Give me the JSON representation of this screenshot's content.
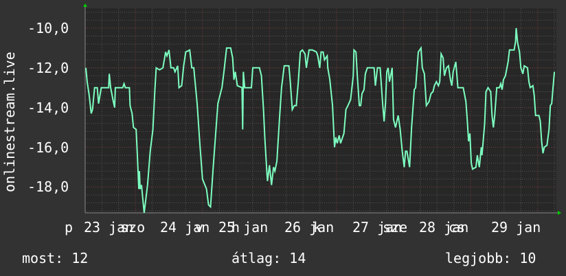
{
  "chart_data": {
    "type": "line",
    "title": "",
    "ylabel": "onlinestream.live",
    "xlabel": "",
    "ylim": [
      -19.3,
      -9.0
    ],
    "xlim": [
      23.25,
      30.28
    ],
    "grid": true,
    "y_ticks": [
      -10,
      -12,
      -14,
      -16,
      -18
    ],
    "y_tick_labels": [
      "-10,0",
      "-12,0",
      "-14,0",
      "-16,0",
      "-18,0"
    ],
    "x_tick_labels": [
      "23 jan",
      "24 jan",
      "25 jan",
      "26 jan",
      "27 jan",
      "28 jan",
      "29 jan"
    ],
    "x_weekday_labels": [
      "p",
      "szo",
      "v",
      "h",
      "k",
      "sze",
      "cs"
    ],
    "colors": {
      "line": "#7dffc0",
      "background": "#323232",
      "plot_background": "#272727",
      "major_grid": "#7a3a3a",
      "minor_grid": "#555555",
      "arrow": "#00cc00"
    },
    "series": [
      {
        "points": [
          [
            23.26,
            -12.0
          ],
          [
            23.28,
            -12.7
          ],
          [
            23.31,
            -13.4
          ],
          [
            23.34,
            -14.3
          ],
          [
            23.36,
            -14.1
          ],
          [
            23.39,
            -13.0
          ],
          [
            23.43,
            -13.0
          ],
          [
            23.45,
            -13.8
          ],
          [
            23.49,
            -13.0
          ],
          [
            23.6,
            -13.0
          ],
          [
            23.61,
            -12.3
          ],
          [
            23.63,
            -13.0
          ],
          [
            23.67,
            -13.7
          ],
          [
            23.69,
            -14.0
          ],
          [
            23.7,
            -13.0
          ],
          [
            23.81,
            -13.0
          ],
          [
            23.83,
            -12.8
          ],
          [
            23.85,
            -13.0
          ],
          [
            23.91,
            -13.0
          ],
          [
            23.92,
            -13.9
          ],
          [
            23.95,
            -14.3
          ],
          [
            23.97,
            -15.0
          ],
          [
            24.01,
            -15.1
          ],
          [
            24.03,
            -16.5
          ],
          [
            24.05,
            -18.1
          ],
          [
            24.06,
            -17.2
          ],
          [
            24.07,
            -18.1
          ],
          [
            24.09,
            -17.9
          ],
          [
            24.11,
            -18.6
          ],
          [
            24.13,
            -19.3
          ],
          [
            24.18,
            -17.9
          ],
          [
            24.22,
            -16.2
          ],
          [
            24.26,
            -15.1
          ],
          [
            24.29,
            -13.1
          ],
          [
            24.31,
            -12.0
          ],
          [
            24.36,
            -12.1
          ],
          [
            24.41,
            -12.0
          ],
          [
            24.45,
            -11.2
          ],
          [
            24.47,
            -11.4
          ],
          [
            24.5,
            -11.1
          ],
          [
            24.53,
            -12.0
          ],
          [
            24.57,
            -12.0
          ],
          [
            24.59,
            -12.2
          ],
          [
            24.63,
            -11.9
          ],
          [
            24.65,
            -13.0
          ],
          [
            24.69,
            -12.9
          ],
          [
            24.72,
            -11.9
          ],
          [
            24.75,
            -11.2
          ],
          [
            24.81,
            -11.1
          ],
          [
            24.84,
            -12.0
          ],
          [
            24.87,
            -12.0
          ],
          [
            24.92,
            -13.8
          ],
          [
            24.96,
            -15.8
          ],
          [
            25.0,
            -17.6
          ],
          [
            25.06,
            -18.1
          ],
          [
            25.09,
            -18.9
          ],
          [
            25.12,
            -19.0
          ],
          [
            25.16,
            -17.0
          ],
          [
            25.23,
            -13.8
          ],
          [
            25.29,
            -13.0
          ],
          [
            25.32,
            -12.2
          ],
          [
            25.36,
            -11.0
          ],
          [
            25.42,
            -11.0
          ],
          [
            25.45,
            -11.5
          ],
          [
            25.47,
            -12.6
          ],
          [
            25.49,
            -12.2
          ],
          [
            25.52,
            -12.9
          ],
          [
            25.59,
            -13.0
          ],
          [
            25.6,
            -15.1
          ],
          [
            25.61,
            -12.2
          ],
          [
            25.63,
            -13.0
          ],
          [
            25.73,
            -13.0
          ],
          [
            25.75,
            -12.0
          ],
          [
            25.85,
            -12.0
          ],
          [
            25.88,
            -12.4
          ],
          [
            25.91,
            -14.1
          ],
          [
            25.93,
            -15.5
          ],
          [
            25.96,
            -17.2
          ],
          [
            25.97,
            -17.7
          ],
          [
            26.0,
            -16.9
          ],
          [
            26.03,
            -17.9
          ],
          [
            26.06,
            -17.0
          ],
          [
            26.08,
            -17.2
          ],
          [
            26.11,
            -16.7
          ],
          [
            26.15,
            -14.5
          ],
          [
            26.18,
            -13.0
          ],
          [
            26.22,
            -11.9
          ],
          [
            26.29,
            -11.9
          ],
          [
            26.31,
            -12.7
          ],
          [
            26.34,
            -14.1
          ],
          [
            26.37,
            -13.9
          ],
          [
            26.4,
            -13.9
          ],
          [
            26.43,
            -12.7
          ],
          [
            26.46,
            -11.2
          ],
          [
            26.49,
            -11.1
          ],
          [
            26.53,
            -11.3
          ],
          [
            26.55,
            -12.0
          ],
          [
            26.59,
            -11.1
          ],
          [
            26.64,
            -11.1
          ],
          [
            26.7,
            -11.2
          ],
          [
            26.72,
            -11.4
          ],
          [
            26.75,
            -12.0
          ],
          [
            26.77,
            -11.2
          ],
          [
            26.8,
            -11.2
          ],
          [
            26.82,
            -11.6
          ],
          [
            26.86,
            -11.4
          ],
          [
            26.87,
            -12.0
          ],
          [
            26.9,
            -12.6
          ],
          [
            26.94,
            -13.9
          ],
          [
            26.97,
            -16.0
          ],
          [
            26.99,
            -15.5
          ],
          [
            27.01,
            -15.8
          ],
          [
            27.04,
            -15.4
          ],
          [
            27.06,
            -15.8
          ],
          [
            27.11,
            -15.3
          ],
          [
            27.14,
            -14.1
          ],
          [
            27.17,
            -13.9
          ],
          [
            27.21,
            -13.6
          ],
          [
            27.25,
            -12.4
          ],
          [
            27.26,
            -11.1
          ],
          [
            27.29,
            -11.2
          ],
          [
            27.31,
            -12.4
          ],
          [
            27.34,
            -13.9
          ],
          [
            27.36,
            -13.9
          ],
          [
            27.38,
            -13.3
          ],
          [
            27.41,
            -13.1
          ],
          [
            27.43,
            -12.3
          ],
          [
            27.46,
            -12.0
          ],
          [
            27.56,
            -12.0
          ],
          [
            27.58,
            -12.9
          ],
          [
            27.61,
            -12.0
          ],
          [
            27.65,
            -12.0
          ],
          [
            27.69,
            -13.9
          ],
          [
            27.71,
            -14.7
          ],
          [
            27.73,
            -13.8
          ],
          [
            27.75,
            -12.2
          ],
          [
            27.77,
            -12.0
          ],
          [
            27.79,
            -12.7
          ],
          [
            27.83,
            -12.0
          ],
          [
            27.85,
            -14.6
          ],
          [
            27.88,
            -15.0
          ],
          [
            27.92,
            -14.4
          ],
          [
            27.95,
            -15.1
          ],
          [
            27.98,
            -16.2
          ],
          [
            28.01,
            -17.0
          ],
          [
            28.03,
            -16.2
          ],
          [
            28.05,
            -16.2
          ],
          [
            28.09,
            -17.0
          ],
          [
            28.12,
            -15.0
          ],
          [
            28.16,
            -13.1
          ],
          [
            28.18,
            -13.0
          ],
          [
            28.22,
            -11.2
          ],
          [
            28.26,
            -11.0
          ],
          [
            28.28,
            -12.0
          ],
          [
            28.31,
            -12.3
          ],
          [
            28.34,
            -13.9
          ],
          [
            28.38,
            -13.7
          ],
          [
            28.41,
            -13.3
          ],
          [
            28.44,
            -13.2
          ],
          [
            28.46,
            -12.9
          ],
          [
            28.49,
            -12.7
          ],
          [
            28.52,
            -12.9
          ],
          [
            28.54,
            -12.7
          ],
          [
            28.56,
            -11.3
          ],
          [
            28.59,
            -11.5
          ],
          [
            28.61,
            -12.4
          ],
          [
            28.64,
            -12.0
          ],
          [
            28.67,
            -11.9
          ],
          [
            28.7,
            -12.6
          ],
          [
            28.72,
            -12.9
          ],
          [
            28.74,
            -12.2
          ],
          [
            28.78,
            -11.7
          ],
          [
            28.81,
            -13.0
          ],
          [
            28.89,
            -13.0
          ],
          [
            28.93,
            -13.7
          ],
          [
            28.95,
            -14.6
          ],
          [
            28.97,
            -15.7
          ],
          [
            28.99,
            -15.3
          ],
          [
            29.01,
            -16.8
          ],
          [
            29.03,
            -17.1
          ],
          [
            29.08,
            -17.0
          ],
          [
            29.1,
            -16.4
          ],
          [
            29.13,
            -17.0
          ],
          [
            29.16,
            -16.0
          ],
          [
            29.17,
            -16.4
          ],
          [
            29.21,
            -14.8
          ],
          [
            29.23,
            -13.2
          ],
          [
            29.26,
            -13.0
          ],
          [
            29.3,
            -13.2
          ],
          [
            29.32,
            -14.4
          ],
          [
            29.34,
            -15.0
          ],
          [
            29.36,
            -14.4
          ],
          [
            29.39,
            -13.0
          ],
          [
            29.43,
            -13.0
          ],
          [
            29.45,
            -12.8
          ],
          [
            29.47,
            -13.1
          ],
          [
            29.49,
            -12.6
          ],
          [
            29.52,
            -12.4
          ],
          [
            29.56,
            -11.7
          ],
          [
            29.58,
            -11.1
          ],
          [
            29.65,
            -11.1
          ],
          [
            29.67,
            -10.7
          ],
          [
            29.68,
            -10.0
          ],
          [
            29.7,
            -10.7
          ],
          [
            29.73,
            -11.2
          ],
          [
            29.75,
            -12.0
          ],
          [
            29.78,
            -12.3
          ],
          [
            29.8,
            -11.9
          ],
          [
            29.85,
            -12.0
          ],
          [
            29.87,
            -12.7
          ],
          [
            29.89,
            -13.0
          ],
          [
            29.93,
            -12.9
          ],
          [
            29.95,
            -13.4
          ],
          [
            29.97,
            -14.4
          ],
          [
            30.02,
            -14.4
          ],
          [
            30.04,
            -14.7
          ],
          [
            30.06,
            -15.7
          ],
          [
            30.08,
            -16.3
          ],
          [
            30.1,
            -16.0
          ],
          [
            30.14,
            -15.9
          ],
          [
            30.17,
            -15.1
          ],
          [
            30.19,
            -13.9
          ],
          [
            30.21,
            -13.8
          ],
          [
            30.23,
            -13.0
          ],
          [
            30.25,
            -12.2
          ]
        ]
      }
    ],
    "legend": {
      "current_label": "most: 12",
      "average_label": "átlag: 14",
      "max_label": "legjobb: 10"
    }
  }
}
